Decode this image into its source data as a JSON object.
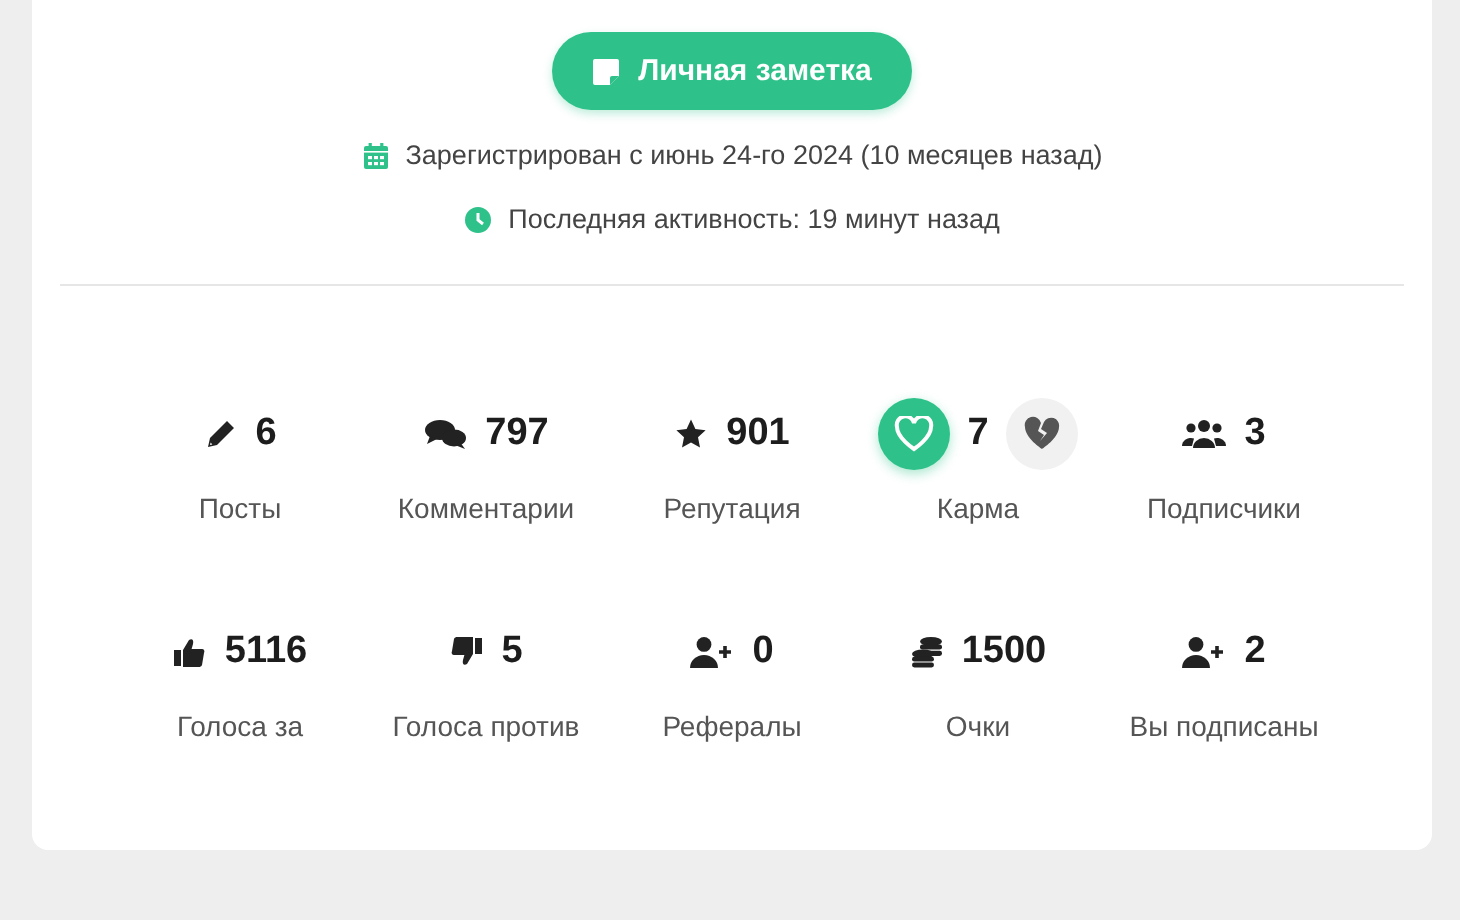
{
  "note_button": {
    "label": "Личная заметка"
  },
  "registered": "Зарегистрирован с июнь 24-го 2024 (10 месяцев назад)",
  "last_active": "Последняя активность: 19 минут назад",
  "stats": [
    {
      "kind": "stat",
      "value": "6",
      "label": "Посты"
    },
    {
      "kind": "stat",
      "value": "797",
      "label": "Комментарии"
    },
    {
      "kind": "stat",
      "value": "901",
      "label": "Репутация"
    },
    {
      "kind": "karma",
      "value": "7",
      "label": "Карма",
      "upvote": {
        "selected": true
      },
      "downvote": {
        "selected": false
      }
    },
    {
      "kind": "stat",
      "value": "3",
      "label": "Подписчики"
    },
    {
      "kind": "stat",
      "value": "5116",
      "label": "Голоса за"
    },
    {
      "kind": "stat",
      "value": "5",
      "label": "Голоса против"
    },
    {
      "kind": "stat",
      "value": "0",
      "label": "Рефералы"
    },
    {
      "kind": "stat",
      "value": "1500",
      "label": "Очки"
    },
    {
      "kind": "stat",
      "value": "2",
      "label": "Вы подписаны"
    }
  ]
}
